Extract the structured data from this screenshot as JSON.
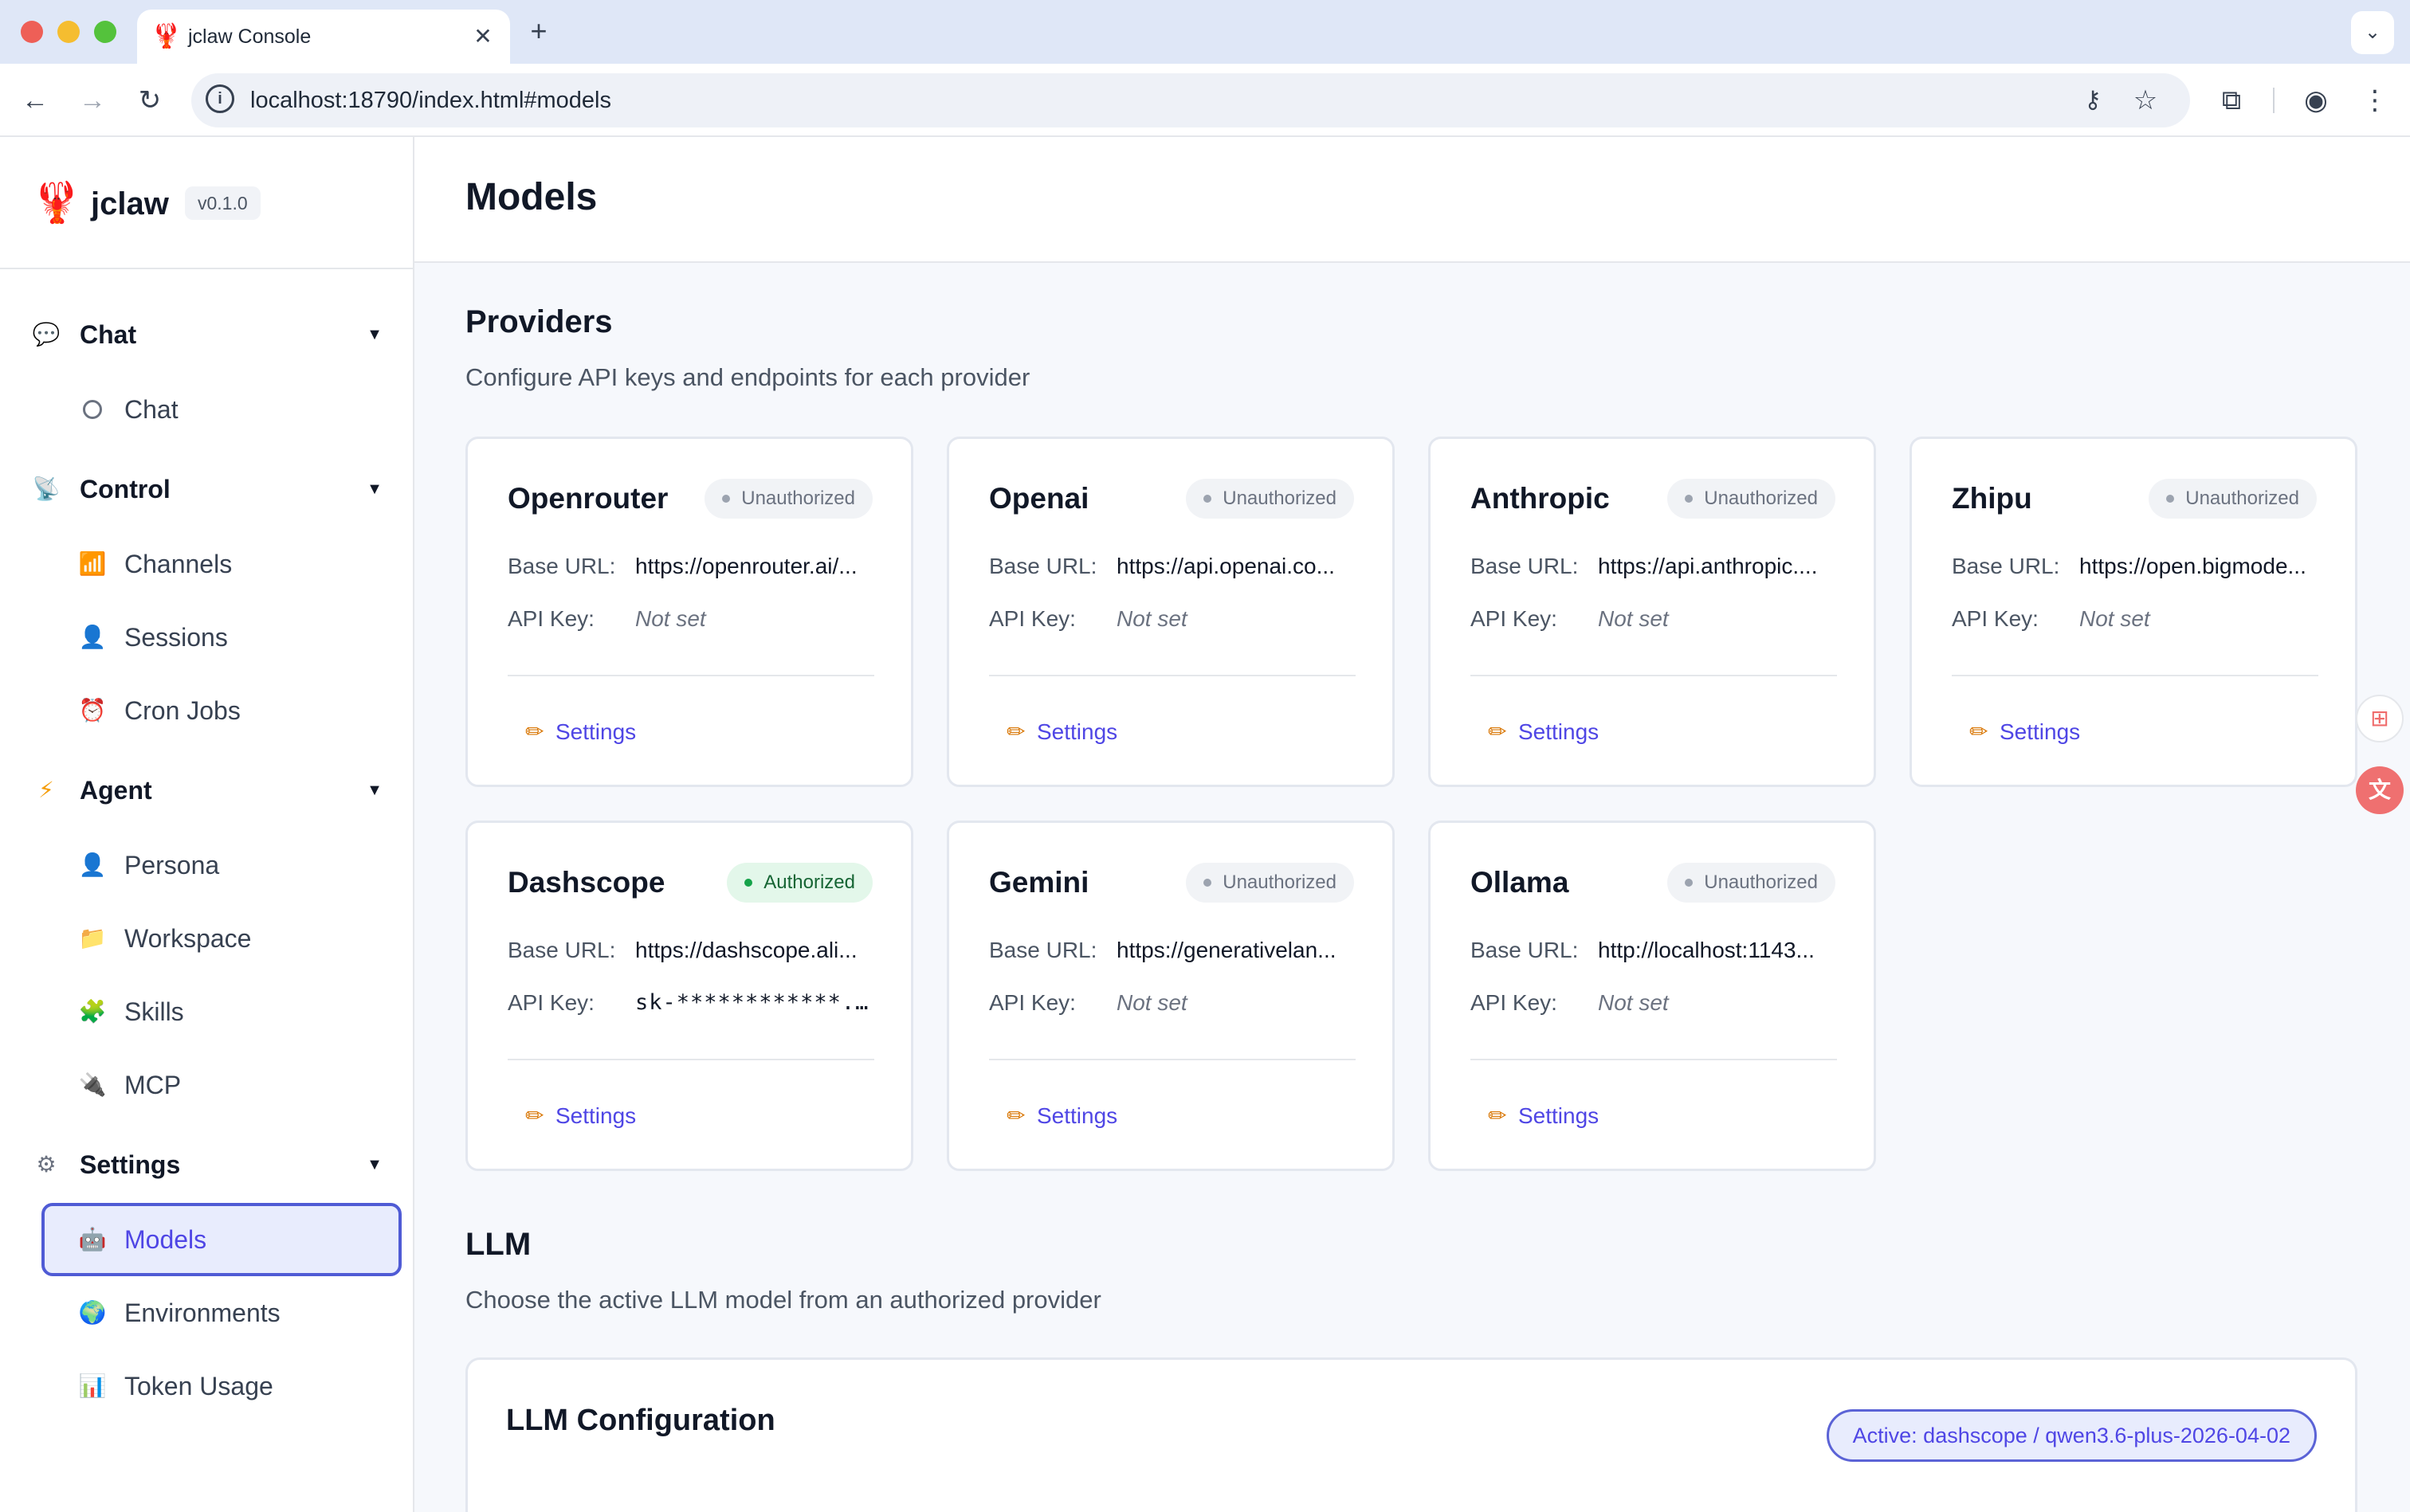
{
  "browser": {
    "tab_title": "jclaw Console",
    "tab_icon": "lobster-icon",
    "close_glyph": "✕",
    "newtab_glyph": "+",
    "tabs_menu_glyph": "⌄",
    "url": "localhost:18790/index.html#models"
  },
  "app": {
    "name": "jclaw",
    "version": "v0.1.0"
  },
  "sidebar": {
    "groups": [
      {
        "label": "Chat",
        "icon": "speech-bubble-icon",
        "items": [
          {
            "label": "Chat",
            "icon": "circle-icon"
          }
        ]
      },
      {
        "label": "Control",
        "icon": "satellite-dish-icon",
        "items": [
          {
            "label": "Channels",
            "icon": "bar-chart-icon"
          },
          {
            "label": "Sessions",
            "icon": "user-icon"
          },
          {
            "label": "Cron Jobs",
            "icon": "alarm-clock-icon"
          }
        ]
      },
      {
        "label": "Agent",
        "icon": "lightning-icon",
        "items": [
          {
            "label": "Persona",
            "icon": "user-icon"
          },
          {
            "label": "Workspace",
            "icon": "folder-icon"
          },
          {
            "label": "Skills",
            "icon": "puzzle-icon"
          },
          {
            "label": "MCP",
            "icon": "plug-icon"
          }
        ]
      },
      {
        "label": "Settings",
        "icon": "gear-icon",
        "items": [
          {
            "label": "Models",
            "icon": "robot-icon",
            "active": true
          },
          {
            "label": "Environments",
            "icon": "globe-icon"
          },
          {
            "label": "Token Usage",
            "icon": "bar-chart-icon"
          }
        ]
      }
    ]
  },
  "page": {
    "title": "Models"
  },
  "providers": {
    "title": "Providers",
    "description": "Configure API keys and endpoints for each provider",
    "base_url_label": "Base URL:",
    "api_key_label": "API Key:",
    "settings_label": "Settings",
    "items": [
      {
        "name": "Openrouter",
        "status": "Unauthorized",
        "base_url": "https://openrouter.ai/...",
        "api_key": "Not set"
      },
      {
        "name": "Openai",
        "status": "Unauthorized",
        "base_url": "https://api.openai.co...",
        "api_key": "Not set"
      },
      {
        "name": "Anthropic",
        "status": "Unauthorized",
        "base_url": "https://api.anthropic....",
        "api_key": "Not set"
      },
      {
        "name": "Zhipu",
        "status": "Unauthorized",
        "base_url": "https://open.bigmode...",
        "api_key": "Not set"
      },
      {
        "name": "Dashscope",
        "status": "Authorized",
        "base_url": "https://dashscope.ali...",
        "api_key": "sk-************..."
      },
      {
        "name": "Gemini",
        "status": "Unauthorized",
        "base_url": "https://generativelan...",
        "api_key": "Not set"
      },
      {
        "name": "Ollama",
        "status": "Unauthorized",
        "base_url": "http://localhost:1143...",
        "api_key": "Not set"
      }
    ]
  },
  "llm": {
    "title": "LLM",
    "description": "Choose the active LLM model from an authorized provider",
    "card_title": "LLM Configuration",
    "active": "Active: dashscope / qwen3.6-plus-2026-04-02"
  },
  "colors": {
    "accent": "#4f46e5",
    "authorized": "#16a34a",
    "unauthorized": "#9ca3af"
  }
}
